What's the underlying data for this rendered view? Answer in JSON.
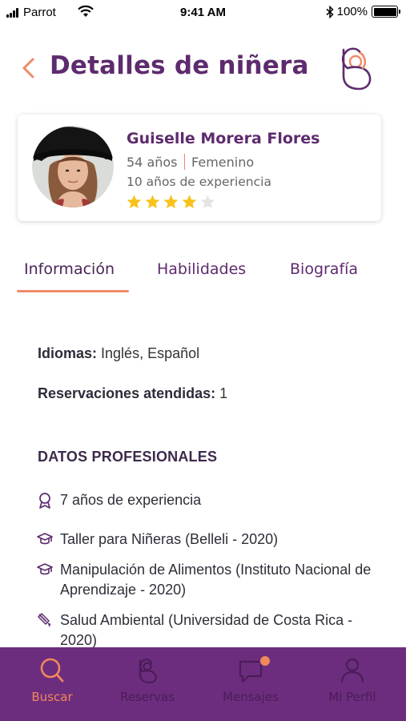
{
  "status_bar": {
    "carrier": "Parrot",
    "time": "9:41 AM",
    "battery": "100%"
  },
  "header": {
    "title": "Detalles de niñera",
    "back_icon": "chevron-left-icon",
    "logo_icon": "babysitter-logo-icon"
  },
  "profile": {
    "name": "Guiselle Morera Flores",
    "age": "54 años",
    "gender": "Femenino",
    "experience": "10 años de experiencia",
    "rating": 4,
    "rating_max": 5
  },
  "tabs": [
    {
      "label": "Información",
      "active": true
    },
    {
      "label": "Habilidades",
      "active": false
    },
    {
      "label": "Biografía",
      "active": false
    }
  ],
  "info": {
    "languages_label": "Idiomas:",
    "languages_value": "Inglés, Español",
    "bookings_label": "Reservaciones atendidas:",
    "bookings_value": "1",
    "section_title": "DATOS PROFESIONALES",
    "items": [
      {
        "icon": "award-icon",
        "text": "7 años de experiencia"
      },
      {
        "icon": "graduation-cap-icon",
        "text": "Taller para Niñeras (Belleli - 2020)"
      },
      {
        "icon": "graduation-cap-icon",
        "text": "Manipulación de Alimentos (Instituto Nacional de Aprendizaje - 2020)"
      },
      {
        "icon": "certificate-icon",
        "text": "Salud Ambiental (Universidad de Costa Rica - 2020)"
      }
    ]
  },
  "bottom_nav": [
    {
      "label": "Buscar",
      "icon": "search-icon",
      "active": true
    },
    {
      "label": "Reservas",
      "icon": "bookings-icon",
      "active": false
    },
    {
      "label": "Mensajes",
      "icon": "messages-icon",
      "active": false,
      "badge": true
    },
    {
      "label": "Mi Perfil",
      "icon": "profile-icon",
      "active": false
    }
  ],
  "colors": {
    "primary": "#5e2b6e",
    "accent": "#f08a68",
    "nav_background": "#6c2d7e",
    "star": "#f7c21b"
  }
}
